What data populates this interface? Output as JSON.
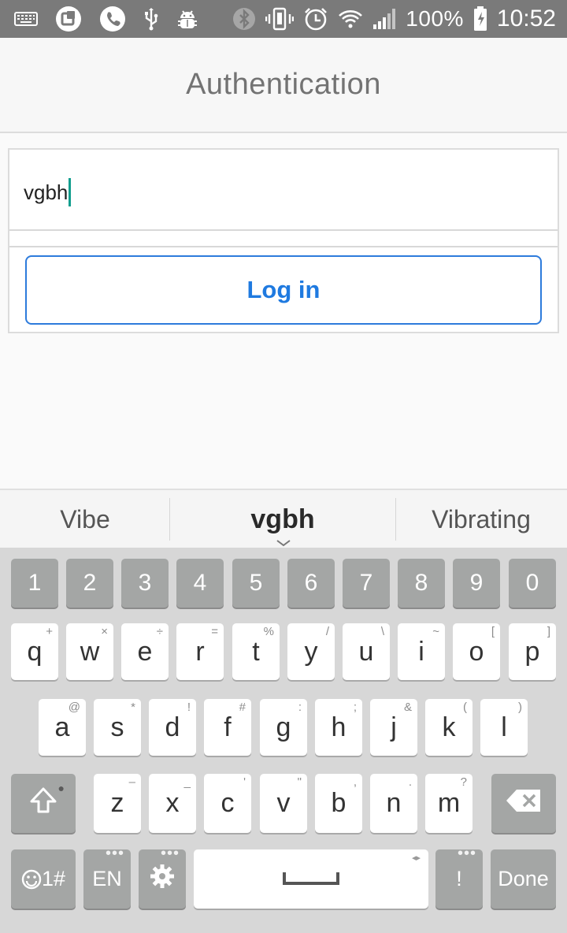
{
  "status_bar": {
    "left_icons": [
      "keyboard-icon",
      "app-notification-icon",
      "phone-icon",
      "usb-icon",
      "android-debug-icon"
    ],
    "right_icons": [
      "bluetooth-icon",
      "vibrate-icon",
      "alarm-icon",
      "wifi-icon",
      "signal-icon",
      "battery-icon"
    ],
    "battery": "100%",
    "time": "10:52"
  },
  "header": {
    "title": "Authentication"
  },
  "form": {
    "input_value": "vgbh",
    "login_label": "Log in",
    "accent_color": "#1f7ae0"
  },
  "suggestions": [
    "Vibe",
    "vgbh",
    "Vibrating"
  ],
  "keyboard": {
    "numbers": [
      "1",
      "2",
      "3",
      "4",
      "5",
      "6",
      "7",
      "8",
      "9",
      "0"
    ],
    "row1": [
      {
        "key": "q",
        "hint": "+"
      },
      {
        "key": "w",
        "hint": "×"
      },
      {
        "key": "e",
        "hint": "÷"
      },
      {
        "key": "r",
        "hint": "="
      },
      {
        "key": "t",
        "hint": "%"
      },
      {
        "key": "y",
        "hint": "/"
      },
      {
        "key": "u",
        "hint": "\\"
      },
      {
        "key": "i",
        "hint": "~"
      },
      {
        "key": "o",
        "hint": "["
      },
      {
        "key": "p",
        "hint": "]"
      }
    ],
    "row2": [
      {
        "key": "a",
        "hint": "@"
      },
      {
        "key": "s",
        "hint": "*"
      },
      {
        "key": "d",
        "hint": "!"
      },
      {
        "key": "f",
        "hint": "#"
      },
      {
        "key": "g",
        "hint": ":"
      },
      {
        "key": "h",
        "hint": ";"
      },
      {
        "key": "j",
        "hint": "&"
      },
      {
        "key": "k",
        "hint": "("
      },
      {
        "key": "l",
        "hint": ")"
      }
    ],
    "row3": [
      {
        "key": "z",
        "hint": "–"
      },
      {
        "key": "x",
        "hint": "_"
      },
      {
        "key": "c",
        "hint": "'"
      },
      {
        "key": "v",
        "hint": "\""
      },
      {
        "key": "b",
        "hint": ","
      },
      {
        "key": "n",
        "hint": "."
      },
      {
        "key": "m",
        "hint": "?"
      }
    ],
    "symbols_label": "1#",
    "language_label": "EN",
    "exclaim_label": "!",
    "done_label": "Done"
  }
}
